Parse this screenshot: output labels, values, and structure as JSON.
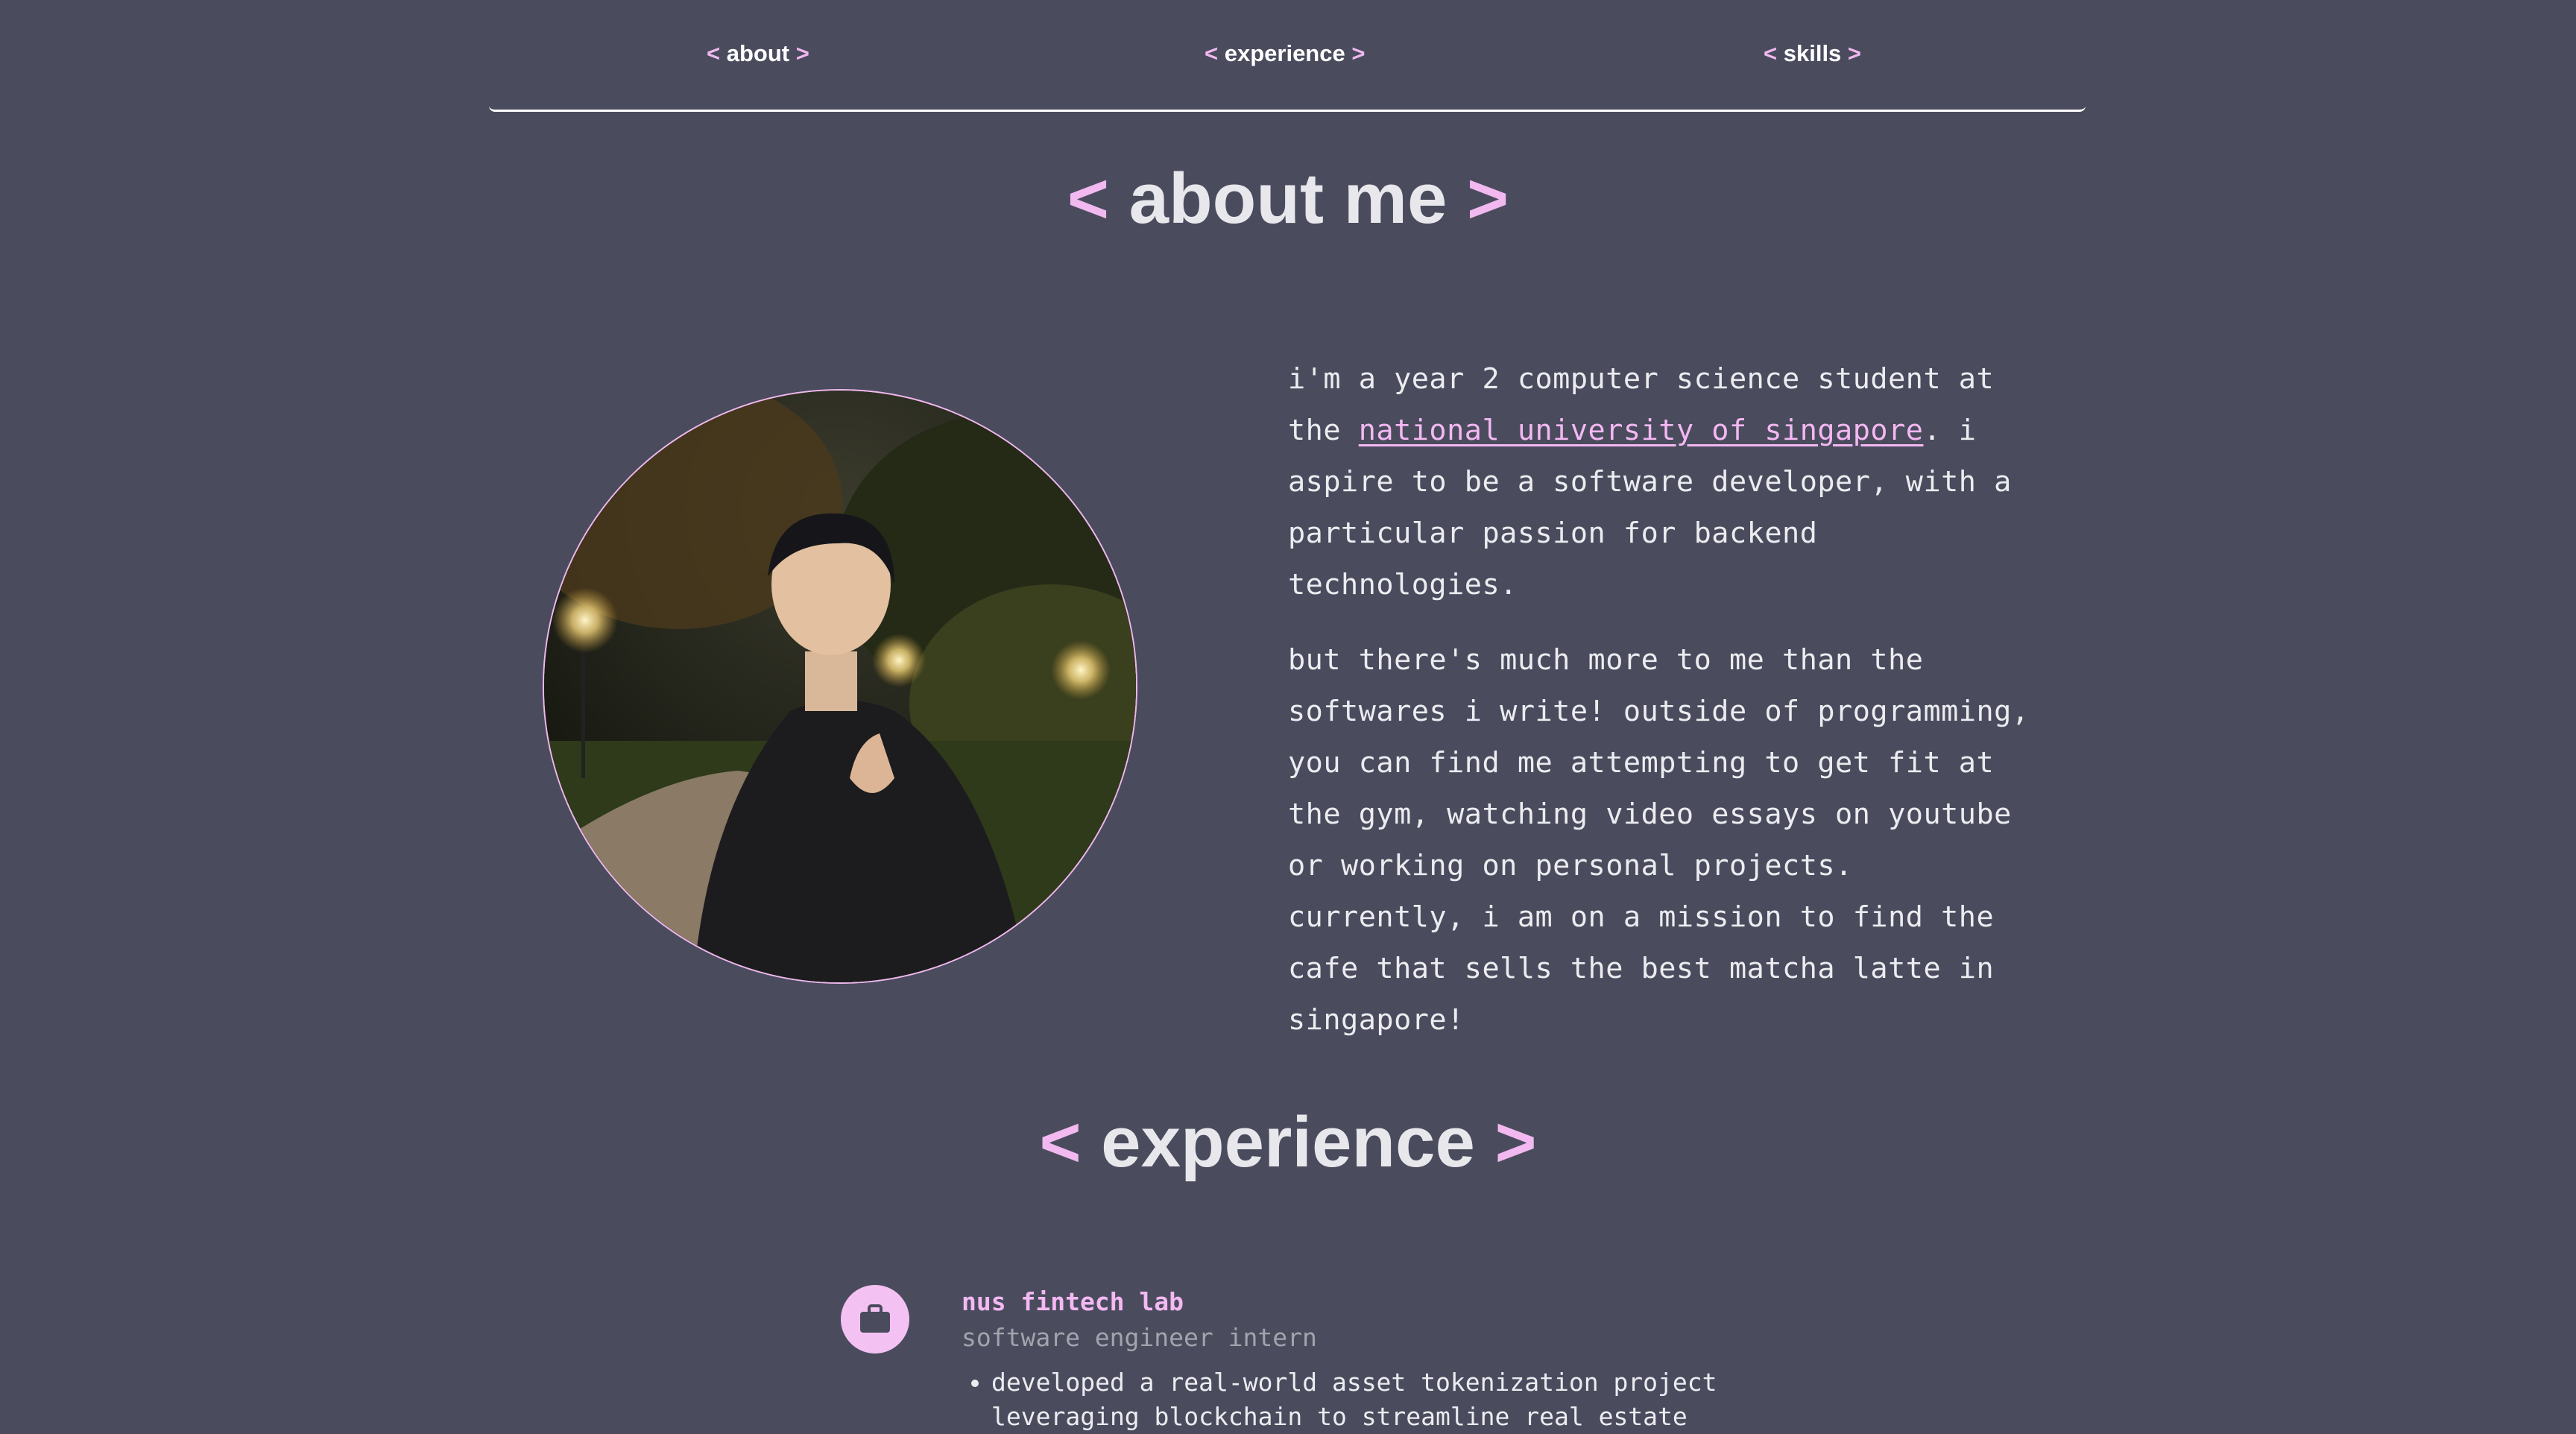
{
  "nav": {
    "items": [
      {
        "open": "<",
        "label": "about",
        "close": ">"
      },
      {
        "open": "<",
        "label": "experience",
        "close": ">"
      },
      {
        "open": "<",
        "label": "skills",
        "close": ">"
      }
    ]
  },
  "about": {
    "heading_open": "<",
    "heading": "about me",
    "heading_close": ">",
    "p1_before": "i'm a year 2 computer science student at the ",
    "p1_link": "national university of singapore",
    "p1_after": ". i aspire to be a software developer, with a particular passion for backend technologies.",
    "p2": "but there's much more to me than the softwares i write! outside of programming, you can find me attempting to get fit at the gym, watching video essays on youtube or working on personal projects. currently, i am on a mission to find the cafe that sells the best matcha latte in singapore!"
  },
  "experience": {
    "heading_open": "<",
    "heading": "experience",
    "heading_close": ">",
    "items": [
      {
        "icon": "briefcase-icon",
        "company": "nus fintech lab",
        "role": "software engineer intern",
        "bullets": [
          "developed a real-world asset tokenization project leveraging blockchain to streamline real estate"
        ]
      }
    ]
  },
  "colors": {
    "background": "#4a4c5e",
    "accent": "#f4b8f2",
    "text": "#ececf0",
    "muted": "#a3a3ad"
  }
}
